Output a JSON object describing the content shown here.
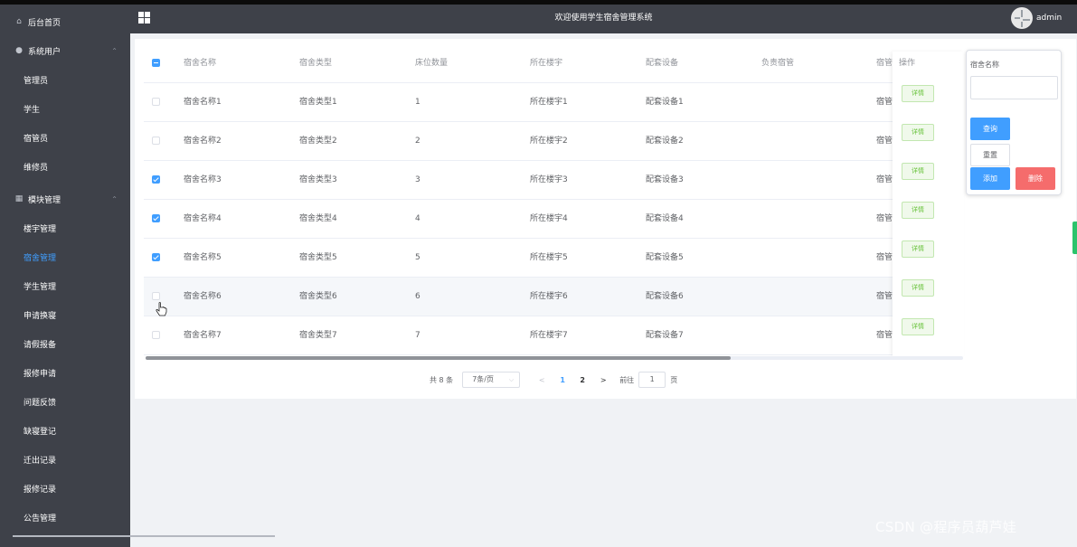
{
  "sidebar": {
    "items": [
      {
        "label": "后台首页",
        "type": "top",
        "icon": "home-icon"
      },
      {
        "label": "系统用户",
        "type": "top",
        "icon": "user-icon",
        "expanded": true
      },
      {
        "label": "管理员",
        "type": "sub"
      },
      {
        "label": "学生",
        "type": "sub"
      },
      {
        "label": "宿管员",
        "type": "sub"
      },
      {
        "label": "维修员",
        "type": "sub"
      },
      {
        "label": "模块管理",
        "type": "top",
        "icon": "grid-icon",
        "expanded": true
      },
      {
        "label": "楼宇管理",
        "type": "sub"
      },
      {
        "label": "宿舍管理",
        "type": "sub",
        "active": true
      },
      {
        "label": "学生管理",
        "type": "sub"
      },
      {
        "label": "申请换寝",
        "type": "sub"
      },
      {
        "label": "请假报备",
        "type": "sub"
      },
      {
        "label": "报修申请",
        "type": "sub"
      },
      {
        "label": "问题反馈",
        "type": "sub"
      },
      {
        "label": "缺寝登记",
        "type": "sub"
      },
      {
        "label": "迁出记录",
        "type": "sub"
      },
      {
        "label": "报修记录",
        "type": "sub"
      },
      {
        "label": "公告管理",
        "type": "sub"
      }
    ]
  },
  "header": {
    "title": "欢迎使用学生宿舍管理系统",
    "username": "admin"
  },
  "table": {
    "columns": [
      "宿舍名称",
      "宿舍类型",
      "床位数量",
      "所在楼宇",
      "配套设备",
      "负责宿管",
      "宿管"
    ],
    "op_header": "操作",
    "header_checkbox": "indeterminate",
    "detail_label": "详情",
    "rows": [
      {
        "checked": false,
        "cells": [
          "宿舍名称1",
          "宿舍类型1",
          "1",
          "所在楼宇1",
          "配套设备1",
          "",
          "宿管"
        ]
      },
      {
        "checked": false,
        "cells": [
          "宿舍名称2",
          "宿舍类型2",
          "2",
          "所在楼宇2",
          "配套设备2",
          "",
          "宿管"
        ]
      },
      {
        "checked": true,
        "cells": [
          "宿舍名称3",
          "宿舍类型3",
          "3",
          "所在楼宇3",
          "配套设备3",
          "",
          "宿管"
        ]
      },
      {
        "checked": true,
        "cells": [
          "宿舍名称4",
          "宿舍类型4",
          "4",
          "所在楼宇4",
          "配套设备4",
          "",
          "宿管"
        ]
      },
      {
        "checked": true,
        "cells": [
          "宿舍名称5",
          "宿舍类型5",
          "5",
          "所在楼宇5",
          "配套设备5",
          "",
          "宿管"
        ]
      },
      {
        "checked": false,
        "cells": [
          "宿舍名称6",
          "宿舍类型6",
          "6",
          "所在楼宇6",
          "配套设备6",
          "",
          "宿管"
        ],
        "hover": true
      },
      {
        "checked": false,
        "cells": [
          "宿舍名称7",
          "宿舍类型7",
          "7",
          "所在楼宇7",
          "配套设备7",
          "",
          "宿管"
        ]
      }
    ]
  },
  "pagination": {
    "total_text": "共 8 条",
    "page_size": "7条/页",
    "prev": "<",
    "pages": [
      "1",
      "2"
    ],
    "current": "1",
    "next": ">",
    "goto_label": "前往",
    "goto_value": "1",
    "page_unit": "页"
  },
  "search": {
    "label": "宿舍名称",
    "value": "",
    "query_button": "查询",
    "reset_button": "重置",
    "add_button": "添加",
    "delete_button": "删除"
  },
  "watermark": "CSDN @程序员葫芦娃",
  "colors": {
    "sidebar_bg": "#3e4149",
    "accent": "#409eff",
    "danger": "#f56c6c",
    "success": "#67c23a"
  }
}
